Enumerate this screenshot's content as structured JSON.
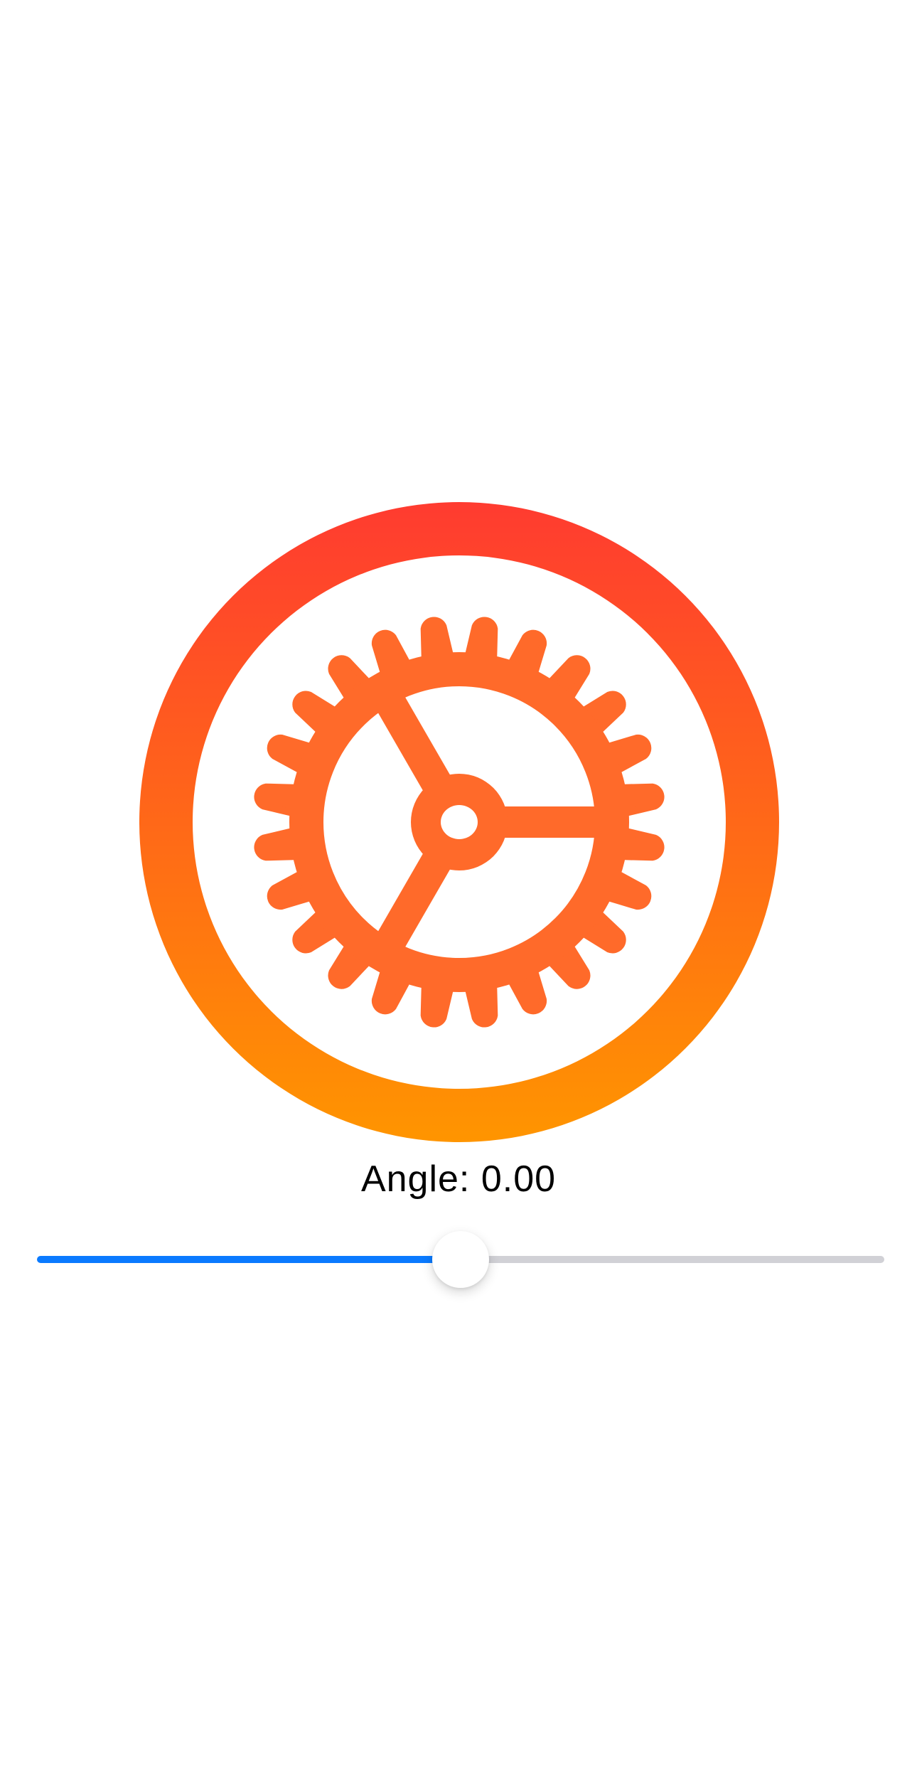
{
  "dial": {
    "ring_gradient_top": "#FF3B30",
    "ring_gradient_bottom": "#FF9500",
    "icon": "gear-icon",
    "icon_color": "#FF6A2A"
  },
  "angle_label": "Angle: 0.00",
  "slider": {
    "value_fraction": 0.5,
    "fill_color": "#0A7AFF",
    "track_color": "#D1D1D6",
    "thumb_color": "#FFFFFF"
  }
}
